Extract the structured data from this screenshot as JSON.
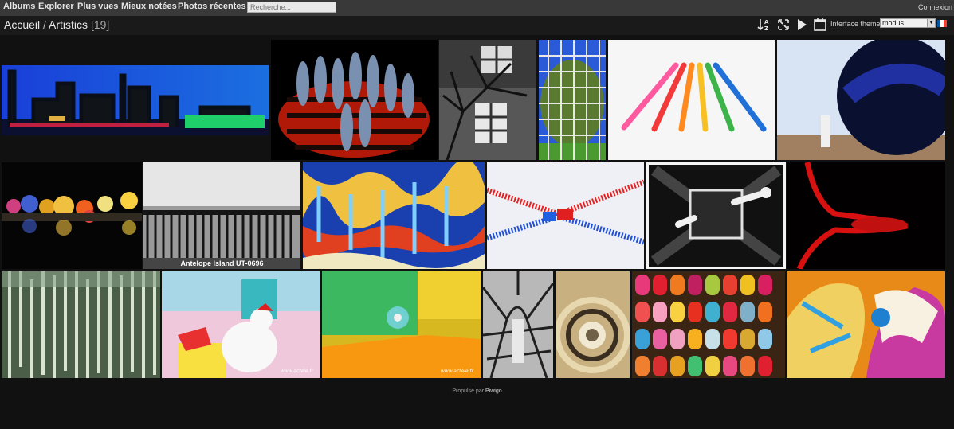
{
  "menu": {
    "albums": "Albums",
    "explore": "Explorer",
    "most_viewed": "Plus vues",
    "best_rated": "Mieux notées",
    "recent": "Photos récentes",
    "search_placeholder": "Recherche...",
    "login": "Connexion"
  },
  "breadcrumb": {
    "home": "Accueil",
    "separator": "/",
    "album": "Artistics",
    "count": "[19]"
  },
  "toolbar": {
    "sort_icon": "sort-az-icon",
    "fullscreen_icon": "expand-arrows-icon",
    "slideshow_icon": "play-icon",
    "calendar_icon": "calendar-icon",
    "theme_label": "Interface theme:",
    "theme_value": "modus",
    "language_flag": "fr-flag-icon"
  },
  "colors": {
    "menubar_bg": "#393939",
    "page_bg": "#111111",
    "flag_blue": "#0055a4",
    "flag_white": "#ffffff",
    "flag_red": "#ef4135"
  },
  "thumbnails": [
    {
      "subject": "steelworks-night",
      "caption": ""
    },
    {
      "subject": "fish-on-grill",
      "caption": ""
    },
    {
      "subject": "tree-shadow-window",
      "caption": ""
    },
    {
      "subject": "tree-reflection-glass",
      "caption": ""
    },
    {
      "subject": "colored-pencils",
      "caption": ""
    },
    {
      "subject": "chrome-sphere",
      "caption": ""
    },
    {
      "subject": "glass-balls",
      "caption": ""
    },
    {
      "subject": "lake-pier-bw",
      "caption": "Antelope Island UT-0696"
    },
    {
      "subject": "soap-bubble-colors",
      "caption": ""
    },
    {
      "subject": "zipper",
      "caption": ""
    },
    {
      "subject": "bw-electrical-plug",
      "caption": ""
    },
    {
      "subject": "red-liquid-drop",
      "caption": ""
    },
    {
      "subject": "ice-curtain",
      "caption": ""
    },
    {
      "subject": "toy-rooster",
      "caption": ""
    },
    {
      "subject": "toy-orange",
      "caption": ""
    },
    {
      "subject": "tree-shadow-figure",
      "caption": ""
    },
    {
      "subject": "spiral-staircase",
      "caption": ""
    },
    {
      "subject": "colorful-slippers",
      "caption": ""
    },
    {
      "subject": "carousel-horses",
      "caption": ""
    }
  ],
  "footer": {
    "powered_by": "Propulsé par",
    "piwigo": "Piwigo"
  }
}
